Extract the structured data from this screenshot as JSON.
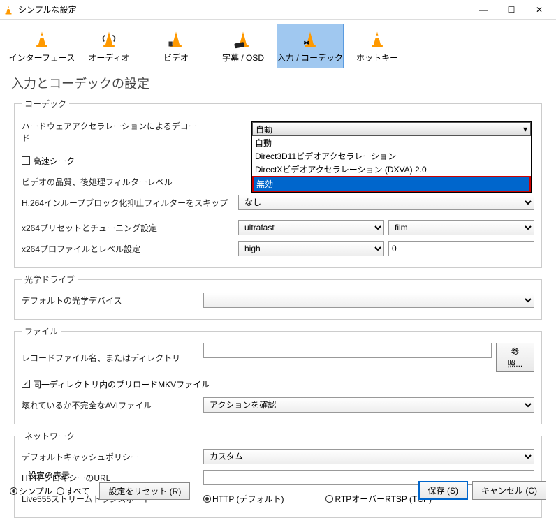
{
  "window": {
    "title": "シンプルな設定"
  },
  "toolbar": {
    "items": [
      {
        "label": "インターフェース"
      },
      {
        "label": "オーディオ"
      },
      {
        "label": "ビデオ"
      },
      {
        "label": "字幕 / OSD"
      },
      {
        "label": "入力 / コーデック"
      },
      {
        "label": "ホットキー"
      }
    ]
  },
  "page_title": "入力とコーデックの設定",
  "codec": {
    "legend": "コーデック",
    "hw_decode_label": "ハードウェアアクセラレーションによるデコード",
    "hw_decode_selected": "自動",
    "hw_decode_options": [
      "自動",
      "Direct3D11ビデオアクセラレーション",
      "DirectXビデオアクセラレーション (DXVA) 2.0",
      "無効"
    ],
    "fast_seek_label": "高速シーク",
    "quality_label": "ビデオの品質、後処理フィルターレベル",
    "h264_skip_label": "H.264インループブロック化抑止フィルターをスキップ",
    "h264_skip_value": "なし",
    "x264_preset_label": "x264プリセットとチューニング設定",
    "x264_preset_value": "ultrafast",
    "x264_tune_value": "film",
    "x264_profile_label": "x264プロファイルとレベル設定",
    "x264_profile_value": "high",
    "x264_level_value": "0"
  },
  "optical": {
    "legend": "光学ドライブ",
    "default_device_label": "デフォルトの光学デバイス"
  },
  "file": {
    "legend": "ファイル",
    "record_label": "レコードファイル名、またはディレクトリ",
    "browse_label": "参照...",
    "preload_mkv_label": "同一ディレクトリ内のプリロードMKVファイル",
    "broken_avi_label": "壊れているか不完全なAVIファイル",
    "broken_avi_value": "アクションを確認"
  },
  "network": {
    "legend": "ネットワーク",
    "cache_policy_label": "デフォルトキャッシュポリシー",
    "cache_policy_value": "カスタム",
    "http_proxy_label": "HTTPプロキシーのURL",
    "live555_label": "Live555ストリームトランスポート",
    "live555_http": "HTTP (デフォルト)",
    "live555_rtp": "RTPオーバーRTSP (TCP)"
  },
  "footer": {
    "show_settings_label": "設定の表示",
    "simple_label": "シンプル",
    "all_label": "すべて",
    "reset_label": "設定をリセット (R)",
    "save_label": "保存 (S)",
    "cancel_label": "キャンセル (C)"
  }
}
